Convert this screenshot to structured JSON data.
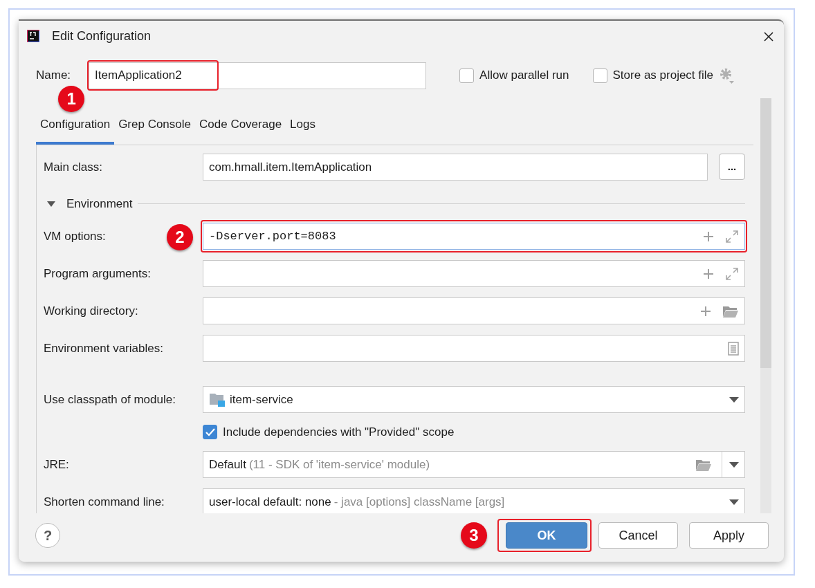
{
  "window": {
    "title": "Edit Configuration"
  },
  "name": {
    "label": "Name:",
    "value": "ItemApplication2",
    "highlighted": true,
    "marker": "1"
  },
  "options": [
    {
      "label": "Allow parallel run",
      "checked": false
    },
    {
      "label": "Store as project file",
      "checked": false
    }
  ],
  "tabs": [
    {
      "label": "Configuration",
      "selected": true
    },
    {
      "label": "Grep Console",
      "selected": false
    },
    {
      "label": "Code Coverage",
      "selected": false
    },
    {
      "label": "Logs",
      "selected": false
    }
  ],
  "rows": [
    {
      "kind": "class_field",
      "label": "Main class:",
      "value": "com.hmall.item.ItemApplication",
      "browse": "..."
    },
    {
      "kind": "section",
      "label": "Environment",
      "expanded": true
    },
    {
      "kind": "expandable_field",
      "label": "VM options:",
      "value": "-Dserver.port=8083",
      "monospace": true,
      "highlighted": true,
      "marker": "2"
    },
    {
      "kind": "expandable_field",
      "label": "Program arguments:"
    },
    {
      "kind": "directory_field",
      "label": "Working directory:"
    },
    {
      "kind": "variables_field",
      "label": "Environment variables:"
    },
    {
      "kind": "module_combo",
      "label": "Use classpath of module:",
      "value": "item-service"
    },
    {
      "kind": "checkbox",
      "label": "Include dependencies with \"Provided\" scope",
      "checked": true
    },
    {
      "kind": "path_combo",
      "label": "JRE:",
      "value": "Default",
      "hint": "(11 - SDK of 'item-service' module)"
    },
    {
      "kind": "combo",
      "label": "Shorten command line:",
      "value": "user-local default: none",
      "hint": "- java [options] className [args]"
    }
  ],
  "help": "?",
  "buttons": [
    {
      "label": "OK",
      "default": true,
      "highlighted": true,
      "marker": "3"
    },
    {
      "label": "Cancel",
      "default": false
    },
    {
      "label": "Apply",
      "default": false
    }
  ]
}
